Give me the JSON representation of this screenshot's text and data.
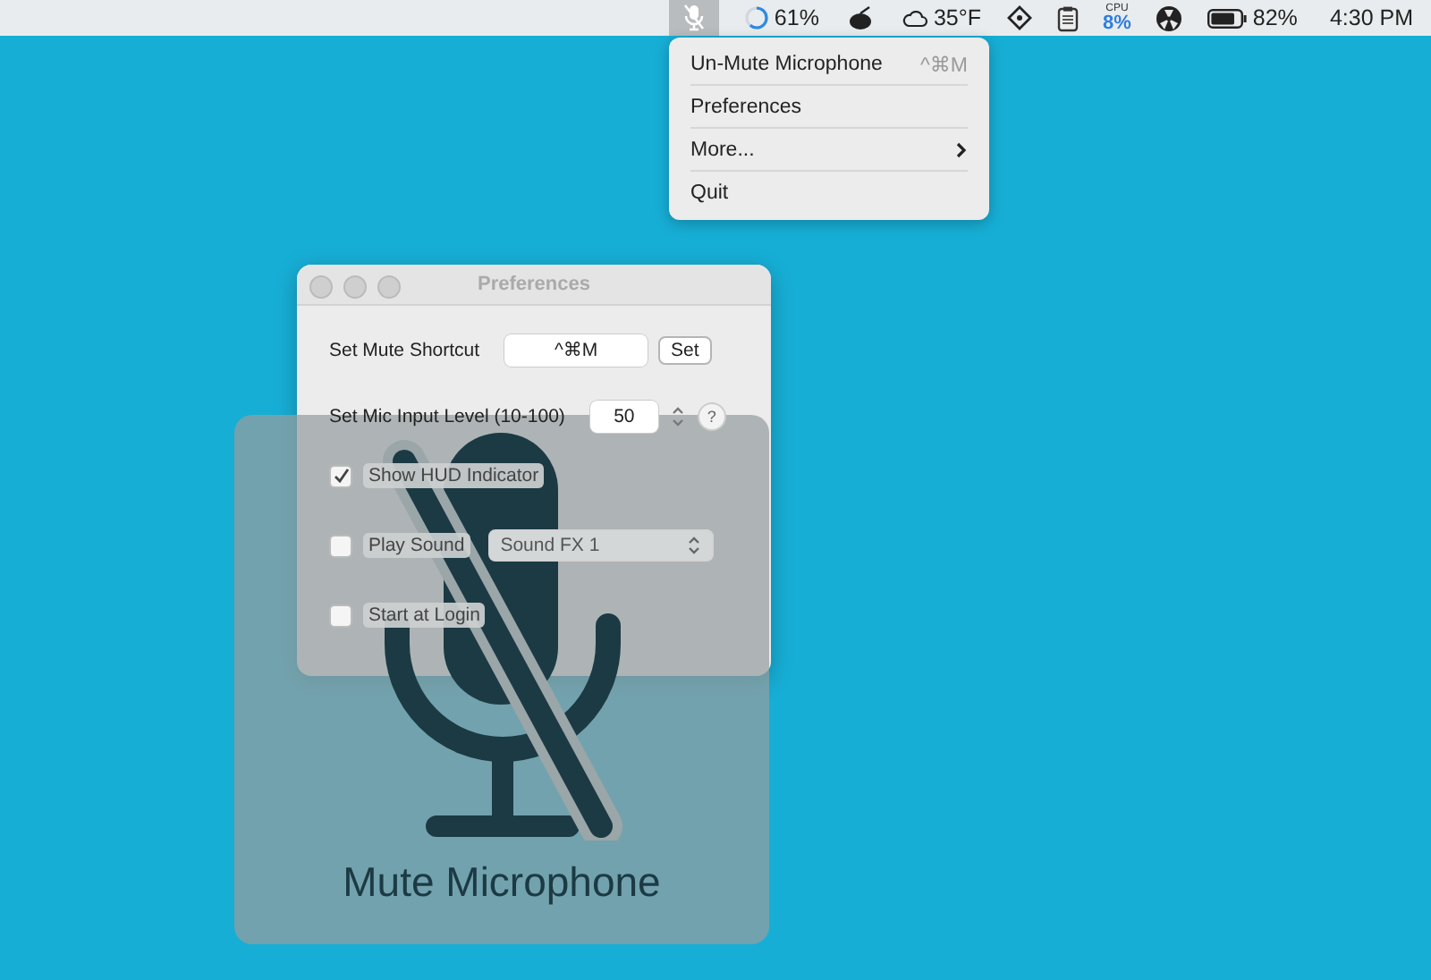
{
  "menu_bar": {
    "items": [
      {
        "kind": "mic",
        "selected": true
      },
      {
        "kind": "ring",
        "text": "61%",
        "level": 0.61
      },
      {
        "kind": "blob"
      },
      {
        "kind": "weather",
        "text": "35°F"
      },
      {
        "kind": "diamond"
      },
      {
        "kind": "clipboard"
      },
      {
        "kind": "cpu",
        "label": "CPU",
        "text": "8%"
      },
      {
        "kind": "fan"
      },
      {
        "kind": "battery",
        "text": "82%",
        "level": 0.82
      },
      {
        "kind": "clock",
        "text": "4:30 PM"
      }
    ]
  },
  "menu": {
    "items": [
      {
        "label": "Un-Mute Microphone",
        "shortcut": "^⌘M",
        "submenu": false
      },
      {
        "label": "Preferences",
        "submenu": false
      },
      {
        "label": "More...",
        "submenu": true
      },
      {
        "label": "Quit",
        "submenu": false
      }
    ]
  },
  "preferences": {
    "title": "Preferences",
    "rows": [
      {
        "kind": "shortcut",
        "label": "Set Mute Shortcut",
        "value": "^⌘M",
        "button": "Set"
      },
      {
        "kind": "stepper",
        "label": "Set Mic Input Level (10-100)",
        "value": "50",
        "help": "?"
      },
      {
        "kind": "checkbox",
        "label": "Show HUD Indicator",
        "checked": true
      },
      {
        "kind": "checkbox-popup",
        "label": "Play Sound",
        "checked": false,
        "popup": "Sound FX 1"
      },
      {
        "kind": "checkbox",
        "label": "Start at Login",
        "checked": false
      }
    ]
  },
  "hud": {
    "label": "Mute Microphone"
  }
}
